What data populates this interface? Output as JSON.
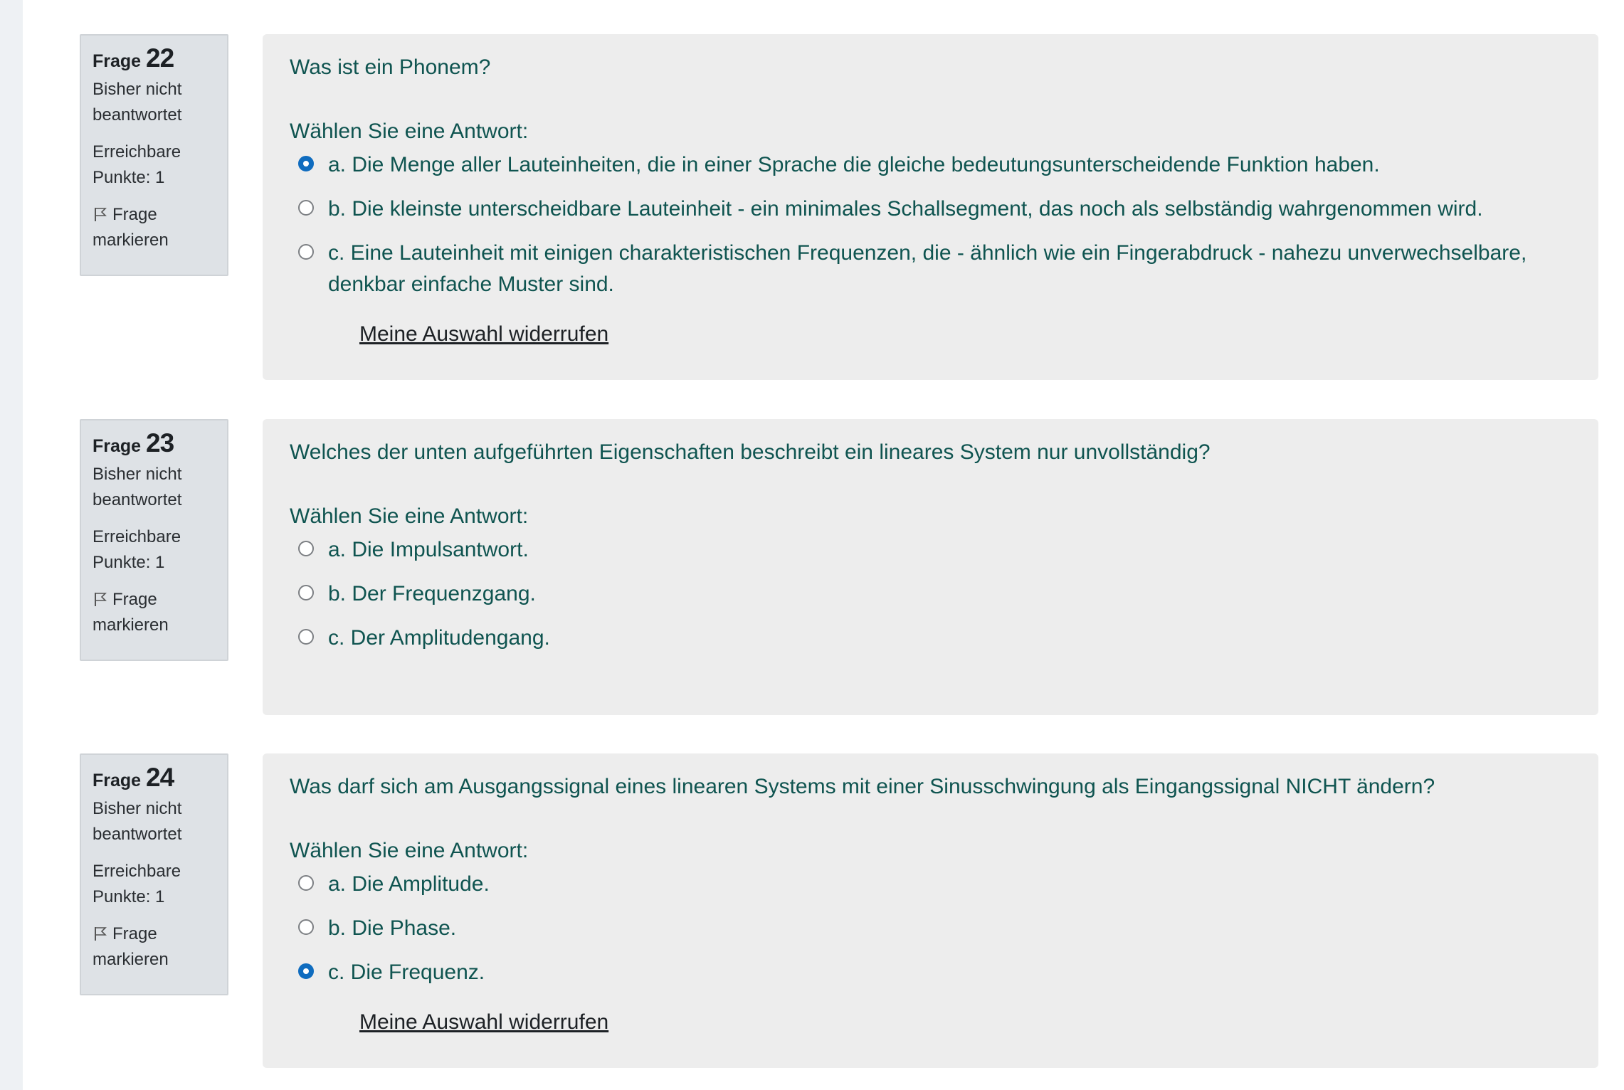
{
  "questions": [
    {
      "label": "Frage",
      "number": "22",
      "state": "Bisher nicht beantwortet",
      "grade": "Erreichbare Punkte: 1",
      "flag_label": "Frage markieren",
      "text": "Was ist ein Phonem?",
      "prompt": "Wählen Sie eine Antwort:",
      "options": [
        {
          "label": "a. Die Menge aller Lauteinheiten, die in einer Sprache die gleiche bedeutungsunterscheidende Funktion haben.",
          "selected": true
        },
        {
          "label": "b. Die kleinste unterscheidbare Lauteinheit - ein minimales Schallsegment, das noch als selbständig wahrgenommen wird.",
          "selected": false
        },
        {
          "label": "c. Eine Lauteinheit mit einigen charakteristischen Frequenzen, die - ähnlich wie ein Fingerabdruck - nahezu unverwechselbare, denkbar einfache Muster sind.",
          "selected": false
        }
      ],
      "clear_label": "Meine Auswahl widerrufen"
    },
    {
      "label": "Frage",
      "number": "23",
      "state": "Bisher nicht beantwortet",
      "grade": "Erreichbare Punkte: 1",
      "flag_label": "Frage markieren",
      "text": "Welches der unten aufgeführten Eigenschaften beschreibt ein lineares System nur unvollständig?",
      "prompt": "Wählen Sie eine Antwort:",
      "options": [
        {
          "label": "a. Die Impulsantwort.",
          "selected": false
        },
        {
          "label": "b. Der Frequenzgang.",
          "selected": false
        },
        {
          "label": "c. Der Amplitudengang.",
          "selected": false
        }
      ]
    },
    {
      "label": "Frage",
      "number": "24",
      "state": "Bisher nicht beantwortet",
      "grade": "Erreichbare Punkte: 1",
      "flag_label": "Frage markieren",
      "text": "Was darf sich am Ausgangssignal eines linearen Systems mit einer Sinusschwingung als Eingangssignal NICHT ändern?",
      "prompt": "Wählen Sie eine Antwort:",
      "options": [
        {
          "label": "a. Die Amplitude.",
          "selected": false
        },
        {
          "label": "b. Die Phase.",
          "selected": false
        },
        {
          "label": "c. Die Frequenz.",
          "selected": true
        }
      ],
      "clear_label": "Meine Auswahl widerrufen"
    }
  ],
  "colors": {
    "accent": "#0f6cbf",
    "text_teal": "#0f5450",
    "info_bg": "#dee2e6",
    "content_bg": "#ededed"
  },
  "icons": {
    "flag": "flag-outline-icon",
    "radio": "radio-button"
  }
}
